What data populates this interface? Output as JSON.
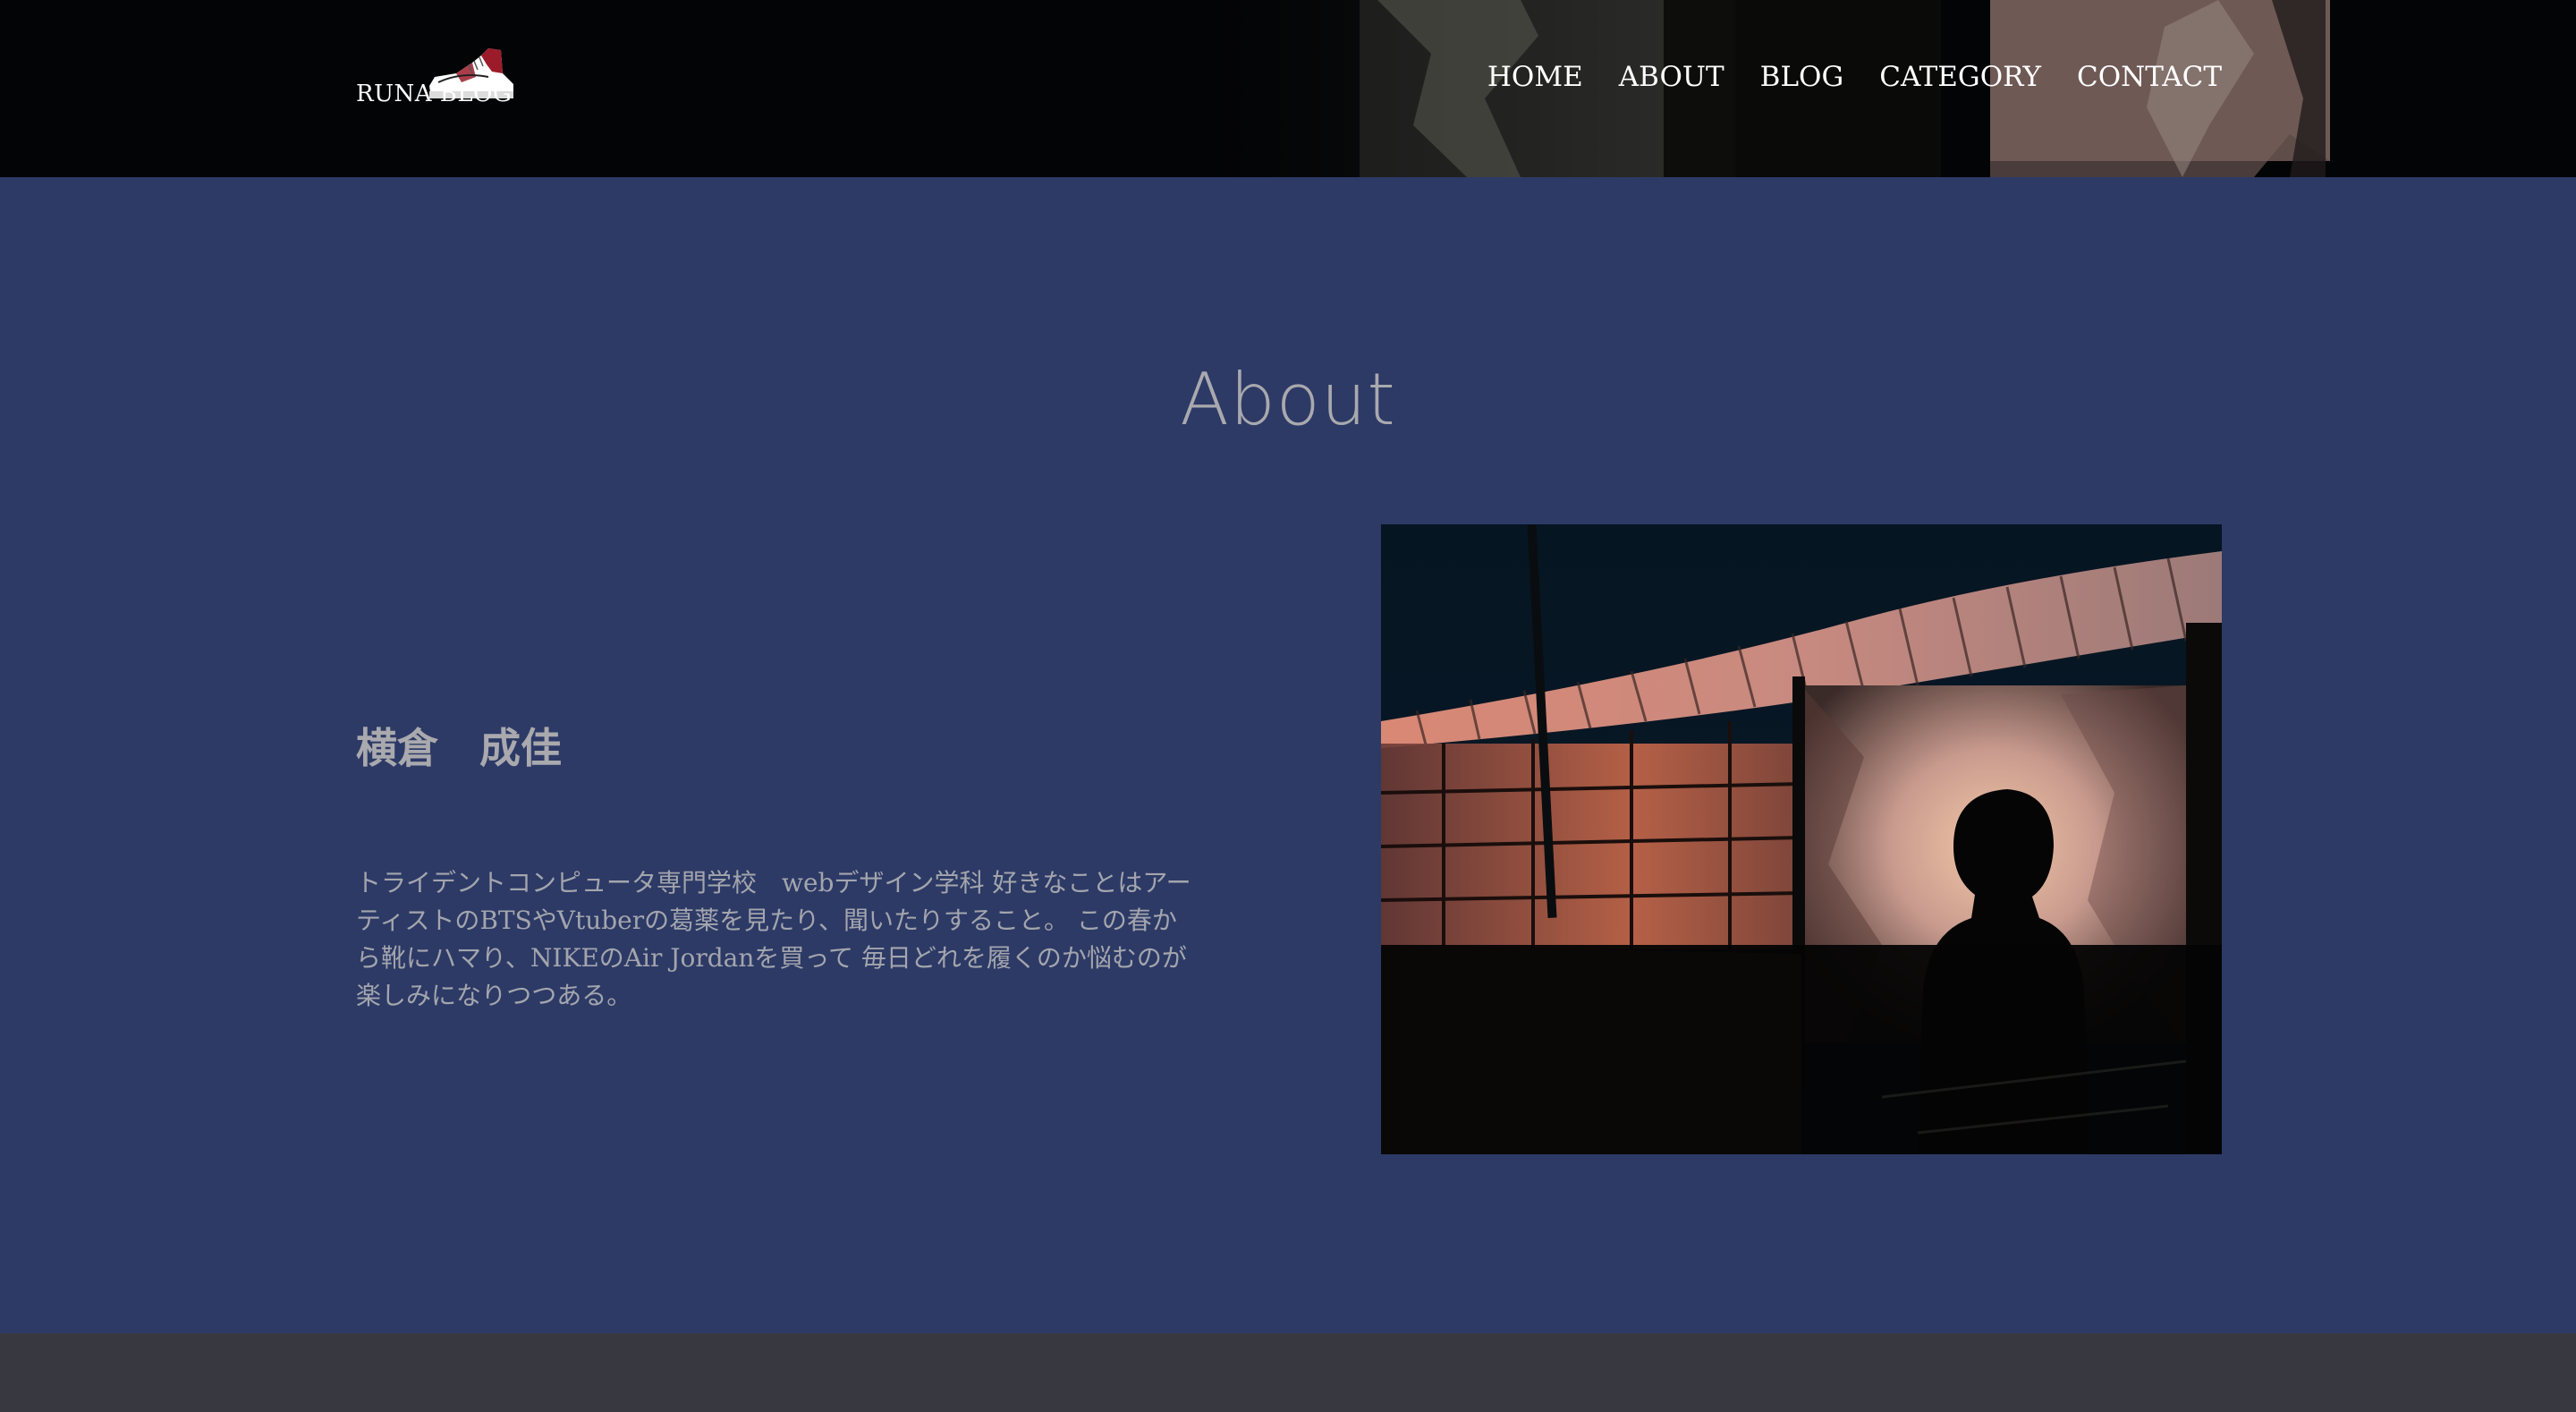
{
  "header": {
    "logo_text": "RUNA BLOG",
    "nav": [
      "HOME",
      "ABOUT",
      "BLOG",
      "CATEGORY",
      "CONTACT"
    ]
  },
  "about": {
    "title": "About",
    "name": "横倉　成佳",
    "bio": "トライデントコンピュータ専門学校　webデザイン学科 好きなことはアーティストのBTSやVtuberの葛薬を見たり、聞いたりすること。 この春から靴にハマり、NIKEのAir Jordanを買って 毎日どれを履くのか悩むのが楽しみになりつつある。"
  },
  "icons": {
    "logo": "sneaker-icon"
  },
  "colors": {
    "header_bg": "#030405",
    "section_bg": "#2d3a66",
    "footer_bg": "#383940",
    "title_text": "#a9a9ae",
    "nav_text": "#ffffff",
    "logo_accent": "#9b1b2a"
  }
}
